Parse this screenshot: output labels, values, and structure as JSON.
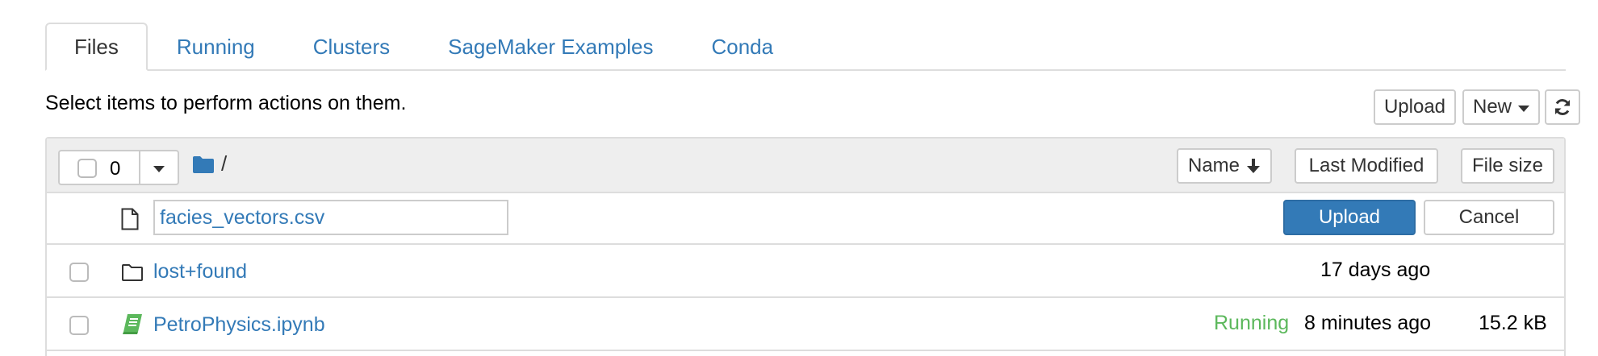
{
  "tabs": [
    {
      "label": "Files",
      "active": true
    },
    {
      "label": "Running",
      "active": false
    },
    {
      "label": "Clusters",
      "active": false
    },
    {
      "label": "SageMaker Examples",
      "active": false
    },
    {
      "label": "Conda",
      "active": false
    }
  ],
  "toolbar": {
    "hint": "Select items to perform actions on them.",
    "upload_label": "Upload",
    "new_label": "New",
    "refresh_icon": "refresh-icon"
  },
  "list_header": {
    "selected_count": "0",
    "path": "/",
    "sort_name_label": "Name",
    "sort_modified_label": "Last Modified",
    "sort_size_label": "File size"
  },
  "pending_upload": {
    "filename": "facies_vectors.csv",
    "upload_label": "Upload",
    "cancel_label": "Cancel"
  },
  "items": [
    {
      "name": "lost+found",
      "type": "folder",
      "status": "",
      "modified": "17 days ago",
      "size": ""
    },
    {
      "name": "PetroPhysics.ipynb",
      "type": "notebook",
      "status": "Running",
      "modified": "8 minutes ago",
      "size": "15.2 kB"
    }
  ],
  "colors": {
    "link": "#337ab7",
    "running": "#5cb85c",
    "primary": "#337ab7",
    "notebook_icon": "#5cb85c"
  }
}
